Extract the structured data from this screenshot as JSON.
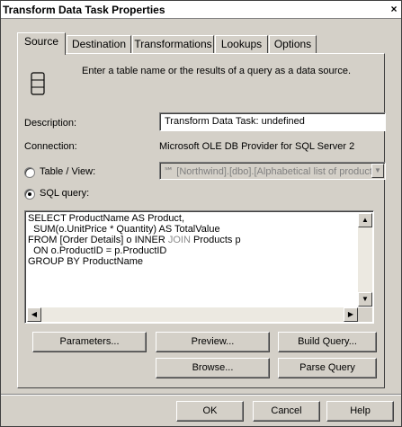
{
  "window": {
    "title": "Transform Data Task Properties",
    "close_glyph": "×"
  },
  "tabs": [
    {
      "label": "Source",
      "active": true
    },
    {
      "label": "Destination",
      "active": false
    },
    {
      "label": "Transformations",
      "active": false
    },
    {
      "label": "Lookups",
      "active": false
    },
    {
      "label": "Options",
      "active": false
    }
  ],
  "source": {
    "intro_text": "Enter a table name or the results of a query as a data source.",
    "description_label": "Description:",
    "description_value": "Transform Data Task: undefined",
    "connection_label": "Connection:",
    "connection_value": "Microsoft OLE DB Provider for SQL Server 2",
    "table_view_label": "Table / View:",
    "table_view_value": "[Northwind].[dbo].[Alphabetical list of products]",
    "table_view_icon_glyph": "℠",
    "sql_query_label": "SQL query:",
    "selected_option": "sql_query",
    "sql_lines": [
      {
        "pre": "SELECT ProductName AS Product,",
        "kw": "",
        "post": ""
      },
      {
        "pre": "  SUM(o.UnitPrice * Quantity) AS TotalValue",
        "kw": "",
        "post": ""
      },
      {
        "pre": "FROM [Order Details] o INNER ",
        "kw": "JOIN",
        "post": " Products p"
      },
      {
        "pre": "  ON o.ProductID = p.ProductID",
        "kw": "",
        "post": ""
      },
      {
        "pre": "GROUP BY ProductName",
        "kw": "",
        "post": ""
      }
    ]
  },
  "buttons": {
    "parameters": "Parameters...",
    "preview": "Preview...",
    "build_query": "Build Query...",
    "browse": "Browse...",
    "parse_query": "Parse Query",
    "ok": "OK",
    "cancel": "Cancel",
    "help": "Help"
  },
  "colors": {
    "dialog_face": "#d4d0c8",
    "disabled_text": "#808080",
    "window_bg": "#ffffff"
  }
}
